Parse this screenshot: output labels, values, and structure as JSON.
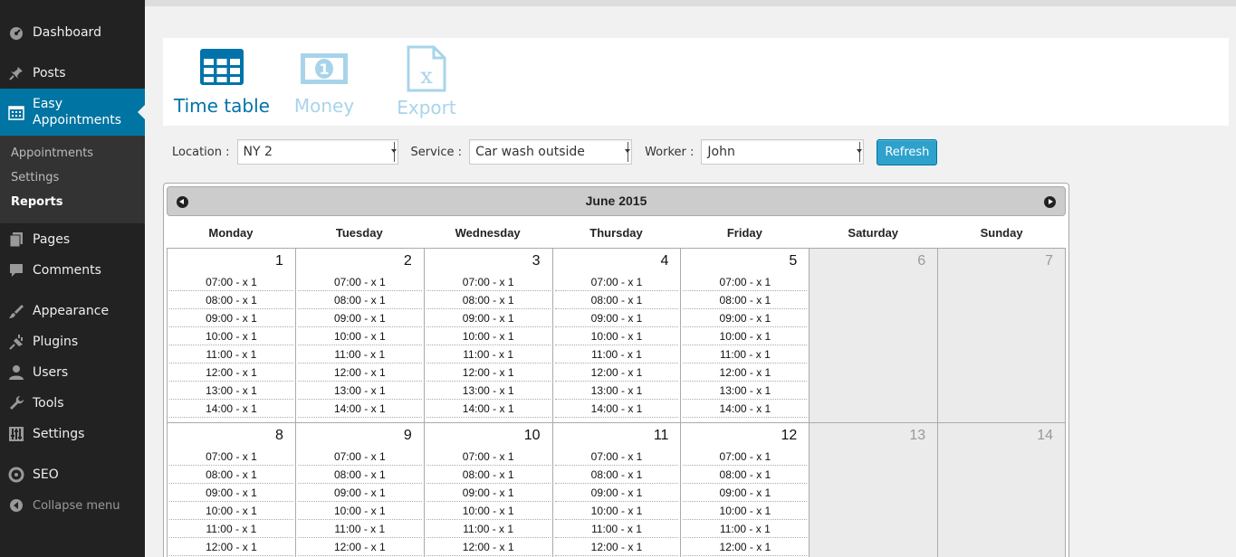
{
  "sidebar": {
    "items_top": [
      {
        "name": "dashboard",
        "label": "Dashboard",
        "icon": "dashboard-icon"
      },
      {
        "name": "posts",
        "label": "Posts",
        "icon": "pin-icon"
      }
    ],
    "active": {
      "label": "Easy\nAppointments",
      "line1": "Easy",
      "line2": "Appointments",
      "icon": "calendar-icon"
    },
    "submenu": [
      {
        "label": "Appointments",
        "current": false
      },
      {
        "label": "Settings",
        "current": false
      },
      {
        "label": "Reports",
        "current": true
      }
    ],
    "items_bottom": [
      {
        "name": "pages",
        "label": "Pages",
        "icon": "pages-icon"
      },
      {
        "name": "comments",
        "label": "Comments",
        "icon": "comment-icon"
      },
      {
        "name": "appearance",
        "label": "Appearance",
        "icon": "brush-icon"
      },
      {
        "name": "plugins",
        "label": "Plugins",
        "icon": "plug-icon"
      },
      {
        "name": "users",
        "label": "Users",
        "icon": "user-icon"
      },
      {
        "name": "tools",
        "label": "Tools",
        "icon": "wrench-icon"
      },
      {
        "name": "settings",
        "label": "Settings",
        "icon": "sliders-icon"
      },
      {
        "name": "seo",
        "label": "SEO",
        "icon": "seo-icon"
      }
    ],
    "collapse_label": "Collapse menu"
  },
  "tabs": [
    {
      "label": "Time table",
      "icon": "table-icon",
      "active": true
    },
    {
      "label": "Money",
      "icon": "money-icon",
      "active": false
    },
    {
      "label": "Export",
      "icon": "excel-file-icon",
      "active": false
    }
  ],
  "filters": {
    "location_label": "Location :",
    "location_value": "NY 2",
    "service_label": "Service :",
    "service_value": "Car wash outside",
    "worker_label": "Worker :",
    "worker_value": "John",
    "refresh_label": "Refresh"
  },
  "calendar": {
    "month_title": "June 2015",
    "days_of_week": [
      "Monday",
      "Tuesday",
      "Wednesday",
      "Thursday",
      "Friday",
      "Saturday",
      "Sunday"
    ],
    "weeks": [
      {
        "days": [
          {
            "num": "1",
            "slots": [
              "07:00 - x 1",
              "08:00 - x 1",
              "09:00 - x 1",
              "10:00 - x 1",
              "11:00 - x 1",
              "12:00 - x 1",
              "13:00 - x 1",
              "14:00 - x 1"
            ]
          },
          {
            "num": "2",
            "slots": [
              "07:00 - x 1",
              "08:00 - x 1",
              "09:00 - x 1",
              "10:00 - x 1",
              "11:00 - x 1",
              "12:00 - x 1",
              "13:00 - x 1",
              "14:00 - x 1"
            ]
          },
          {
            "num": "3",
            "slots": [
              "07:00 - x 1",
              "08:00 - x 1",
              "09:00 - x 1",
              "10:00 - x 1",
              "11:00 - x 1",
              "12:00 - x 1",
              "13:00 - x 1",
              "14:00 - x 1"
            ]
          },
          {
            "num": "4",
            "slots": [
              "07:00 - x 1",
              "08:00 - x 1",
              "09:00 - x 1",
              "10:00 - x 1",
              "11:00 - x 1",
              "12:00 - x 1",
              "13:00 - x 1",
              "14:00 - x 1"
            ]
          },
          {
            "num": "5",
            "slots": [
              "07:00 - x 1",
              "08:00 - x 1",
              "09:00 - x 1",
              "10:00 - x 1",
              "11:00 - x 1",
              "12:00 - x 1",
              "13:00 - x 1",
              "14:00 - x 1"
            ]
          },
          {
            "num": "6",
            "slots": []
          },
          {
            "num": "7",
            "slots": []
          }
        ]
      },
      {
        "days": [
          {
            "num": "8",
            "slots": [
              "07:00 - x 1",
              "08:00 - x 1",
              "09:00 - x 1",
              "10:00 - x 1",
              "11:00 - x 1",
              "12:00 - x 1"
            ]
          },
          {
            "num": "9",
            "slots": [
              "07:00 - x 1",
              "08:00 - x 1",
              "09:00 - x 1",
              "10:00 - x 1",
              "11:00 - x 1",
              "12:00 - x 1"
            ]
          },
          {
            "num": "10",
            "slots": [
              "07:00 - x 1",
              "08:00 - x 1",
              "09:00 - x 1",
              "10:00 - x 1",
              "11:00 - x 1",
              "12:00 - x 1"
            ]
          },
          {
            "num": "11",
            "slots": [
              "07:00 - x 1",
              "08:00 - x 1",
              "09:00 - x 1",
              "10:00 - x 1",
              "11:00 - x 1",
              "12:00 - x 1"
            ]
          },
          {
            "num": "12",
            "slots": [
              "07:00 - x 1",
              "08:00 - x 1",
              "09:00 - x 1",
              "10:00 - x 1",
              "11:00 - x 1",
              "12:00 - x 1"
            ]
          },
          {
            "num": "13",
            "slots": []
          },
          {
            "num": "14",
            "slots": []
          }
        ]
      }
    ]
  },
  "colors": {
    "sidebar_bg": "#222222",
    "active_menu": "#0074a2",
    "tab_active": "#0073aa",
    "tab_inactive": "#a8d4ea",
    "refresh_button": "#2ea2cc"
  }
}
